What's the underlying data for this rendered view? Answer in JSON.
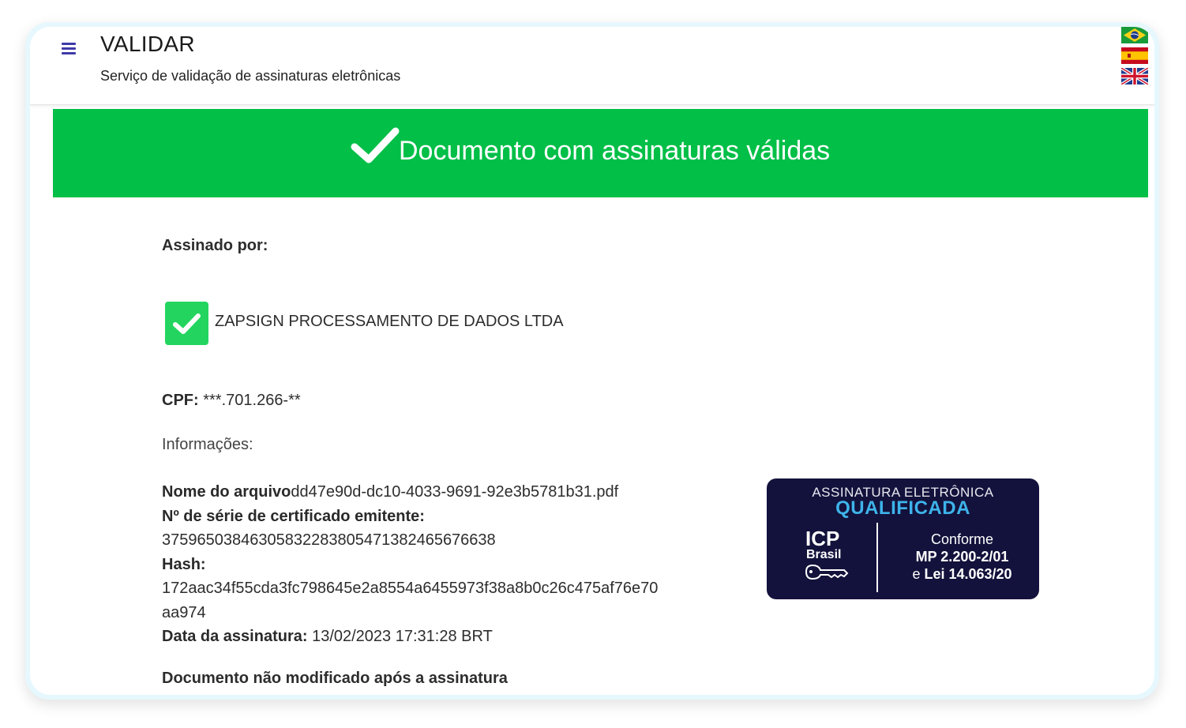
{
  "header": {
    "title": "VALIDAR",
    "subtitle": "Serviço de validação de assinaturas eletrônicas",
    "menu_icon": "hamburger-menu-icon",
    "languages": [
      "pt-BR",
      "es",
      "en"
    ]
  },
  "banner": {
    "message": "Documento com assinaturas válidas",
    "color": "#01bf47"
  },
  "signature": {
    "signed_by_label": "Assinado por:",
    "signer_name": "ZAPSIGN PROCESSAMENTO DE DADOS LTDA",
    "cpf_label": "CPF:",
    "cpf_value": "***.701.266-**",
    "info_label": "Informações:",
    "file_name_label": "Nome do arquivo",
    "file_name_value": "dd47e90d-dc10-4033-9691-92e3b5781b31.pdf",
    "serial_label": "Nº de série de certificado emitente:",
    "serial_value": "37596503846305832283805471382465676638",
    "hash_label": "Hash:",
    "hash_value": "172aac34f55cda3fc798645e2a8554a6455973f38a8b0c26c475af76e70aa974",
    "date_label": "Data da assinatura:",
    "date_value": "13/02/2023 17:31:28 BRT",
    "not_modified": "Documento não modificado após a assinatura"
  },
  "seal": {
    "title": "ASSINATURA ELETRÔNICA",
    "subtitle": "QUALIFICADA",
    "icp": "ICP",
    "brasil": "Brasil",
    "conforme": "Conforme",
    "mp": "MP 2.200-2/01",
    "lei_prefix": "e",
    "lei": "Lei 14.063/20",
    "bg_color": "#13123c",
    "accent_color": "#3db4ea"
  }
}
